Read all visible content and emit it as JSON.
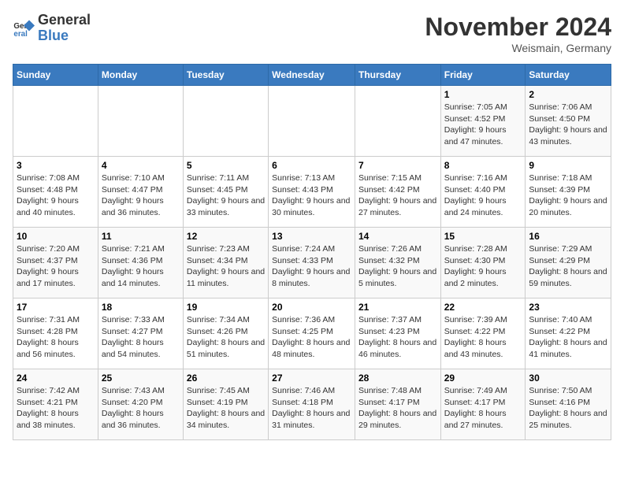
{
  "header": {
    "logo_line1": "General",
    "logo_line2": "Blue",
    "month": "November 2024",
    "location": "Weismain, Germany"
  },
  "days_of_week": [
    "Sunday",
    "Monday",
    "Tuesday",
    "Wednesday",
    "Thursday",
    "Friday",
    "Saturday"
  ],
  "weeks": [
    [
      {
        "day": "",
        "info": ""
      },
      {
        "day": "",
        "info": ""
      },
      {
        "day": "",
        "info": ""
      },
      {
        "day": "",
        "info": ""
      },
      {
        "day": "",
        "info": ""
      },
      {
        "day": "1",
        "info": "Sunrise: 7:05 AM\nSunset: 4:52 PM\nDaylight: 9 hours and 47 minutes."
      },
      {
        "day": "2",
        "info": "Sunrise: 7:06 AM\nSunset: 4:50 PM\nDaylight: 9 hours and 43 minutes."
      }
    ],
    [
      {
        "day": "3",
        "info": "Sunrise: 7:08 AM\nSunset: 4:48 PM\nDaylight: 9 hours and 40 minutes."
      },
      {
        "day": "4",
        "info": "Sunrise: 7:10 AM\nSunset: 4:47 PM\nDaylight: 9 hours and 36 minutes."
      },
      {
        "day": "5",
        "info": "Sunrise: 7:11 AM\nSunset: 4:45 PM\nDaylight: 9 hours and 33 minutes."
      },
      {
        "day": "6",
        "info": "Sunrise: 7:13 AM\nSunset: 4:43 PM\nDaylight: 9 hours and 30 minutes."
      },
      {
        "day": "7",
        "info": "Sunrise: 7:15 AM\nSunset: 4:42 PM\nDaylight: 9 hours and 27 minutes."
      },
      {
        "day": "8",
        "info": "Sunrise: 7:16 AM\nSunset: 4:40 PM\nDaylight: 9 hours and 24 minutes."
      },
      {
        "day": "9",
        "info": "Sunrise: 7:18 AM\nSunset: 4:39 PM\nDaylight: 9 hours and 20 minutes."
      }
    ],
    [
      {
        "day": "10",
        "info": "Sunrise: 7:20 AM\nSunset: 4:37 PM\nDaylight: 9 hours and 17 minutes."
      },
      {
        "day": "11",
        "info": "Sunrise: 7:21 AM\nSunset: 4:36 PM\nDaylight: 9 hours and 14 minutes."
      },
      {
        "day": "12",
        "info": "Sunrise: 7:23 AM\nSunset: 4:34 PM\nDaylight: 9 hours and 11 minutes."
      },
      {
        "day": "13",
        "info": "Sunrise: 7:24 AM\nSunset: 4:33 PM\nDaylight: 9 hours and 8 minutes."
      },
      {
        "day": "14",
        "info": "Sunrise: 7:26 AM\nSunset: 4:32 PM\nDaylight: 9 hours and 5 minutes."
      },
      {
        "day": "15",
        "info": "Sunrise: 7:28 AM\nSunset: 4:30 PM\nDaylight: 9 hours and 2 minutes."
      },
      {
        "day": "16",
        "info": "Sunrise: 7:29 AM\nSunset: 4:29 PM\nDaylight: 8 hours and 59 minutes."
      }
    ],
    [
      {
        "day": "17",
        "info": "Sunrise: 7:31 AM\nSunset: 4:28 PM\nDaylight: 8 hours and 56 minutes."
      },
      {
        "day": "18",
        "info": "Sunrise: 7:33 AM\nSunset: 4:27 PM\nDaylight: 8 hours and 54 minutes."
      },
      {
        "day": "19",
        "info": "Sunrise: 7:34 AM\nSunset: 4:26 PM\nDaylight: 8 hours and 51 minutes."
      },
      {
        "day": "20",
        "info": "Sunrise: 7:36 AM\nSunset: 4:25 PM\nDaylight: 8 hours and 48 minutes."
      },
      {
        "day": "21",
        "info": "Sunrise: 7:37 AM\nSunset: 4:23 PM\nDaylight: 8 hours and 46 minutes."
      },
      {
        "day": "22",
        "info": "Sunrise: 7:39 AM\nSunset: 4:22 PM\nDaylight: 8 hours and 43 minutes."
      },
      {
        "day": "23",
        "info": "Sunrise: 7:40 AM\nSunset: 4:22 PM\nDaylight: 8 hours and 41 minutes."
      }
    ],
    [
      {
        "day": "24",
        "info": "Sunrise: 7:42 AM\nSunset: 4:21 PM\nDaylight: 8 hours and 38 minutes."
      },
      {
        "day": "25",
        "info": "Sunrise: 7:43 AM\nSunset: 4:20 PM\nDaylight: 8 hours and 36 minutes."
      },
      {
        "day": "26",
        "info": "Sunrise: 7:45 AM\nSunset: 4:19 PM\nDaylight: 8 hours and 34 minutes."
      },
      {
        "day": "27",
        "info": "Sunrise: 7:46 AM\nSunset: 4:18 PM\nDaylight: 8 hours and 31 minutes."
      },
      {
        "day": "28",
        "info": "Sunrise: 7:48 AM\nSunset: 4:17 PM\nDaylight: 8 hours and 29 minutes."
      },
      {
        "day": "29",
        "info": "Sunrise: 7:49 AM\nSunset: 4:17 PM\nDaylight: 8 hours and 27 minutes."
      },
      {
        "day": "30",
        "info": "Sunrise: 7:50 AM\nSunset: 4:16 PM\nDaylight: 8 hours and 25 minutes."
      }
    ]
  ]
}
